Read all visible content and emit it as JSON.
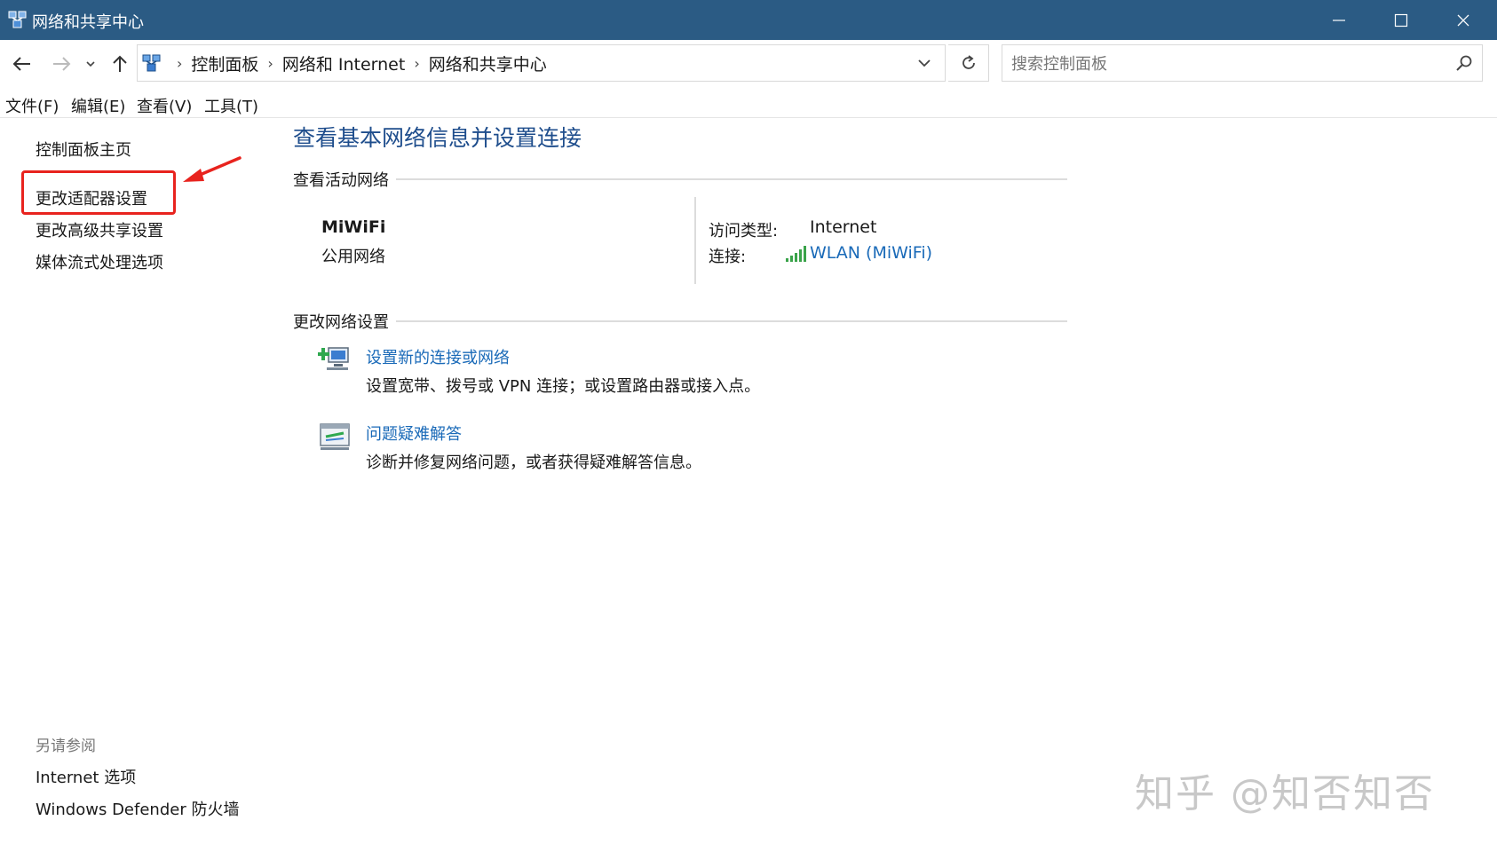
{
  "window": {
    "title": "网络和共享中心"
  },
  "address": {
    "crumbs": [
      "控制面板",
      "网络和 Internet",
      "网络和共享中心"
    ]
  },
  "search": {
    "placeholder": "搜索控制面板"
  },
  "menu": {
    "items": [
      "文件(F)",
      "编辑(E)",
      "查看(V)",
      "工具(T)"
    ]
  },
  "sidebar": {
    "items": [
      "控制面板主页",
      "更改适配器设置",
      "更改高级共享设置",
      "媒体流式处理选项"
    ],
    "see_also_title": "另请参阅",
    "see_also": [
      "Internet 选项",
      "Windows Defender 防火墙"
    ]
  },
  "main": {
    "title": "查看基本网络信息并设置连接",
    "active_section": "查看活动网络",
    "network": {
      "name": "MiWiFi",
      "type": "公用网络",
      "access_label": "访问类型:",
      "access_value": "Internet",
      "connection_label": "连接:",
      "connection_value": "WLAN (MiWiFi)"
    },
    "change_section": "更改网络设置",
    "tasks": [
      {
        "link": "设置新的连接或网络",
        "desc": "设置宽带、拨号或 VPN 连接；或设置路由器或接入点。"
      },
      {
        "link": "问题疑难解答",
        "desc": "诊断并修复网络问题，或者获得疑难解答信息。"
      }
    ]
  },
  "watermark": "知乎 @知否知否",
  "colors": {
    "titlebar": "#2b5b84",
    "link": "#1a6ab8",
    "heading": "#1e4d8c",
    "annotation": "#e8231e"
  }
}
